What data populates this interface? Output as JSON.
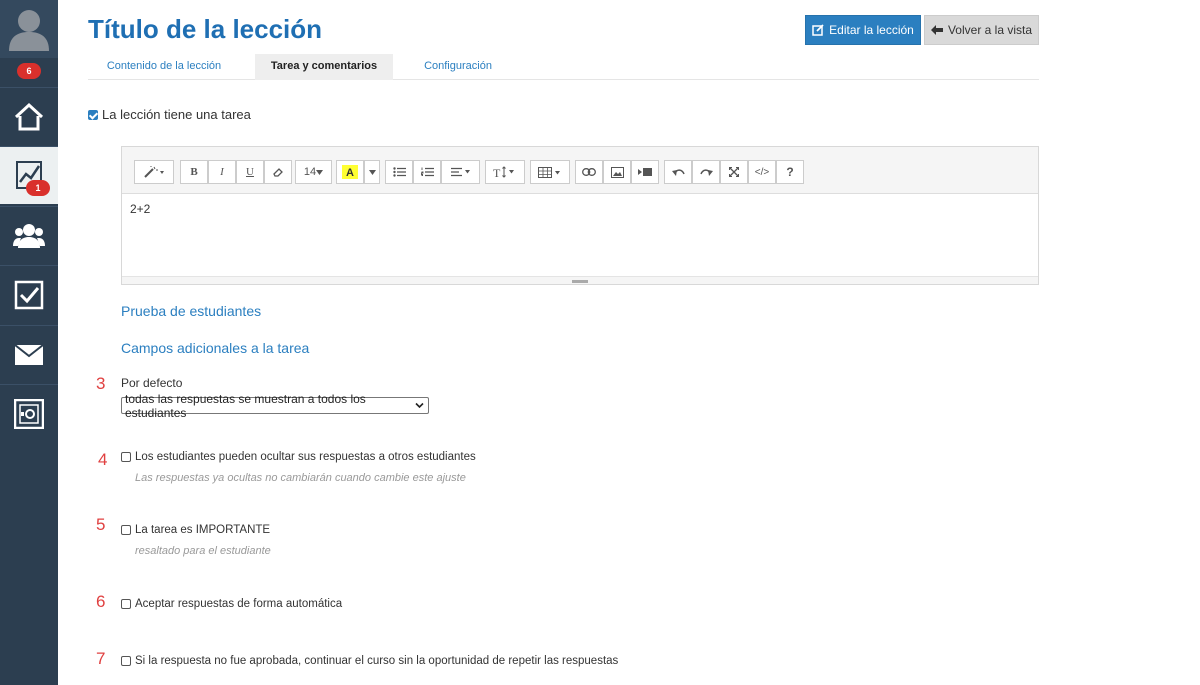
{
  "sidebar": {
    "avatar_badge": "6",
    "items": [
      {
        "name": "home-icon"
      },
      {
        "name": "chart-icon",
        "badge": "1"
      },
      {
        "name": "users-icon"
      },
      {
        "name": "checkbox-icon"
      },
      {
        "name": "mail-icon"
      },
      {
        "name": "safe-icon"
      }
    ]
  },
  "header": {
    "title": "Título de la lección",
    "edit_button": "Editar la lección",
    "back_button": "Volver a la vista"
  },
  "tabs": [
    {
      "label": "Contenido de la lección",
      "active": false
    },
    {
      "label": "Tarea y comentarios",
      "active": true
    },
    {
      "label": "Configuración",
      "active": false
    }
  ],
  "task_checkbox": {
    "label": "La lección tiene una tarea",
    "checked": true
  },
  "editor": {
    "font_size": "14",
    "content": "2+2",
    "code_label": "</>",
    "help_label": "?"
  },
  "links": {
    "student_test": "Prueba de estudiantes",
    "extra_fields": "Campos adicionales a la tarea"
  },
  "options": {
    "default": {
      "number": "3",
      "label": "Por defecto",
      "select_value": "todas las respuestas se muestran a todos los estudiantes"
    },
    "hide_answers": {
      "number": "4",
      "label": "Los estudiantes pueden ocultar sus respuestas a otros estudiantes",
      "hint": "Las respuestas ya ocultas no cambiarán cuando cambie este ajuste",
      "checked": false
    },
    "important": {
      "number": "5",
      "label": "La tarea es IMPORTANTE",
      "hint": "resaltado para el estudiante",
      "checked": false
    },
    "auto_accept": {
      "number": "6",
      "label": "Aceptar respuestas de forma automática",
      "checked": false
    },
    "continue_course": {
      "number": "7",
      "label": "Si la respuesta no fue aprobada, continuar el curso sin la oportunidad de repetir las respuestas",
      "checked": false
    }
  },
  "colors": {
    "sidebar": "#2c3e50",
    "accent": "#2b7fc0",
    "badge": "#d9302c",
    "number": "#e04040"
  }
}
